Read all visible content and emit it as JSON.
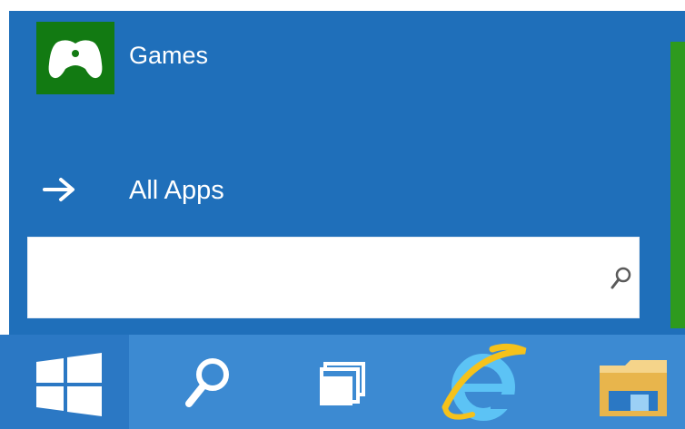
{
  "start_menu": {
    "items": [
      {
        "label": "Games",
        "icon": "gamepad-icon"
      },
      {
        "label": "All Apps",
        "icon": "arrow-right-icon"
      }
    ],
    "search": {
      "value": "",
      "placeholder": "",
      "icon": "search-icon"
    }
  },
  "taskbar": {
    "buttons": [
      {
        "name": "start",
        "icon": "windows-logo-icon"
      },
      {
        "name": "search",
        "icon": "search-icon"
      },
      {
        "name": "task-view",
        "icon": "task-view-icon"
      },
      {
        "name": "internet-explorer",
        "icon": "internet-explorer-icon"
      },
      {
        "name": "file-explorer",
        "icon": "folder-icon"
      }
    ]
  },
  "colors": {
    "start_menu_bg": "#1f6fba",
    "taskbar_bg": "#3c8ad2",
    "start_button_bg": "#2b78c4",
    "games_tile": "#127a12",
    "live_tile_strip": "#2e9a1e",
    "text": "#ffffff"
  }
}
